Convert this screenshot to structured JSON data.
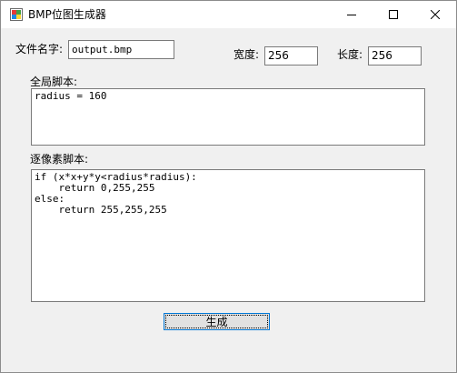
{
  "window": {
    "title": "BMP位图生成器",
    "icon": "bitmap-app-icon",
    "controls": {
      "minimize": "minimize-icon",
      "maximize": "maximize-icon",
      "close": "close-icon"
    }
  },
  "form": {
    "filename_label": "文件名字:",
    "filename_value": "output.bmp",
    "width_label": "宽度:",
    "width_value": "256",
    "height_label": "长度:",
    "height_value": "256",
    "global_script_label": "全局脚本:",
    "global_script_value": "radius = 160",
    "pixel_script_label": "逐像素脚本:",
    "pixel_script_value": "if (x*x+y*y<radius*radius):\n    return 0,255,255\nelse:\n    return 255,255,255",
    "generate_label": "生成"
  },
  "colors": {
    "window_bg": "#f0f0f0",
    "titlebar_bg": "#ffffff",
    "focus_border": "#0078d7"
  }
}
